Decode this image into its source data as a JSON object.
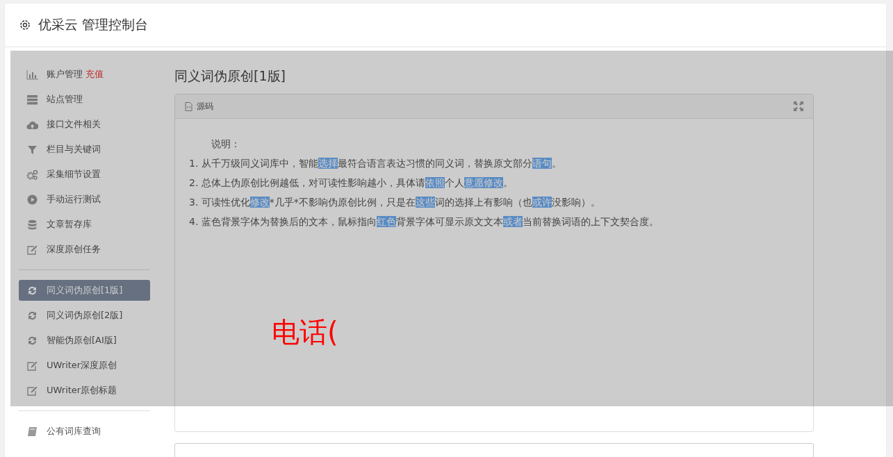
{
  "header": {
    "title": "优采云 管理控制台"
  },
  "sidebar": {
    "groups": [
      [
        {
          "kind": "chart",
          "label": "账户管理",
          "badge": "充值",
          "selected": false
        },
        {
          "kind": "server",
          "label": "站点管理",
          "selected": false
        },
        {
          "kind": "cloud",
          "label": "接口文件相关",
          "selected": false
        },
        {
          "kind": "filter",
          "label": "栏目与关键词",
          "selected": false
        },
        {
          "kind": "cogs",
          "label": "采集细节设置",
          "selected": false
        },
        {
          "kind": "play",
          "label": "手动运行测试",
          "selected": false
        },
        {
          "kind": "database",
          "label": "文章暂存库",
          "selected": false
        },
        {
          "kind": "edit",
          "label": "深度原创任务",
          "selected": false
        }
      ],
      [
        {
          "kind": "refresh",
          "label": "同义词伪原创[1版]",
          "selected": true
        },
        {
          "kind": "refresh",
          "label": "同义词伪原创[2版]",
          "selected": false
        },
        {
          "kind": "refresh",
          "label": "智能伪原创[AI版]",
          "selected": false
        },
        {
          "kind": "edit",
          "label": "UWriter深度原创",
          "selected": false
        },
        {
          "kind": "edit",
          "label": "UWriter原创标题",
          "selected": false
        }
      ],
      [
        {
          "kind": "book",
          "label": "公有词库查询",
          "selected": false
        }
      ]
    ]
  },
  "main": {
    "title": "同义词伪原创[1版]",
    "editor": {
      "tab": "源码",
      "intro": "说明：",
      "lines": [
        [
          {
            "text": "1. 从千万级同义词库中，智能",
            "highlight": false
          },
          {
            "text": "选择",
            "highlight": true
          },
          {
            "text": "最符合语言表达习惯的同义词，替换原文部分",
            "highlight": false
          },
          {
            "text": "语句",
            "highlight": true
          },
          {
            "text": "。",
            "highlight": false
          }
        ],
        [
          {
            "text": "2. 总体上伪原创比例越低，对可读性影响越小，具体请",
            "highlight": false
          },
          {
            "text": "依照",
            "highlight": true
          },
          {
            "text": "个人",
            "highlight": false
          },
          {
            "text": "意愿",
            "highlight": true
          },
          {
            "text": "修改",
            "highlight": true
          },
          {
            "text": "。",
            "highlight": false
          }
        ],
        [
          {
            "text": "3. 可读性优化",
            "highlight": false
          },
          {
            "text": "修改",
            "highlight": true
          },
          {
            "text": "*几乎*不影响伪原创比例，只是在",
            "highlight": false
          },
          {
            "text": "这些",
            "highlight": true
          },
          {
            "text": "词的选择上有影响（也",
            "highlight": false
          },
          {
            "text": "或许",
            "highlight": true
          },
          {
            "text": "没影响）。",
            "highlight": false
          }
        ],
        [
          {
            "text": "4. 蓝色背景字体为替换后的文本，鼠标指向",
            "highlight": false
          },
          {
            "text": "红色",
            "highlight": true
          },
          {
            "text": "背景字体可显示原文文本",
            "highlight": false
          },
          {
            "text": "或者",
            "highlight": true
          },
          {
            "text": "当前替换词语的上下文契合度。",
            "highlight": false
          }
        ]
      ]
    }
  },
  "overlay": {
    "text": "电话("
  }
}
